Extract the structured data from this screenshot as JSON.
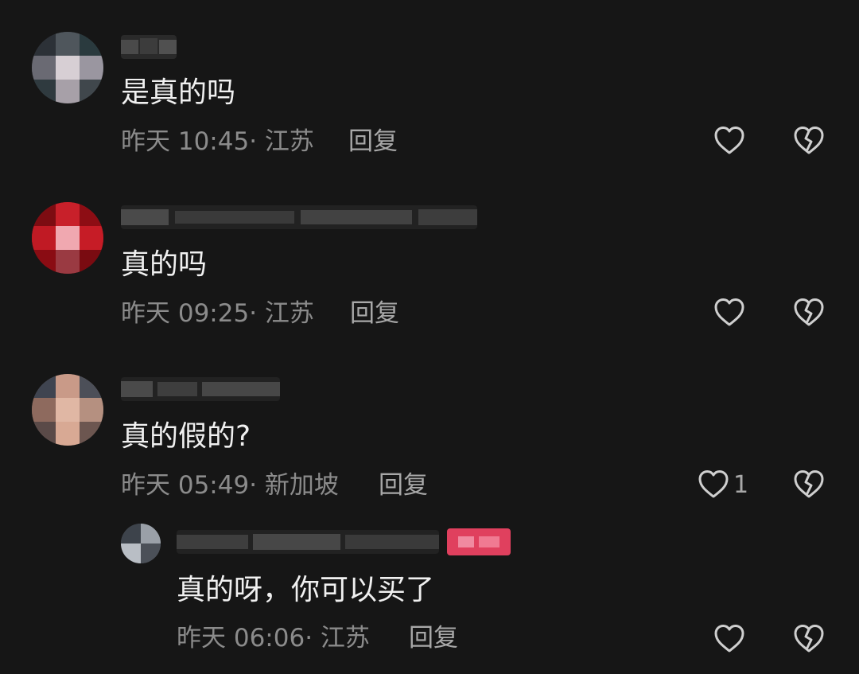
{
  "comments": [
    {
      "text": "是真的吗",
      "meta": "昨天 10:45· 江苏",
      "reply_label": "回复",
      "like_count": ""
    },
    {
      "text": "真的吗",
      "meta": "昨天 09:25· 江苏",
      "reply_label": "回复",
      "like_count": ""
    },
    {
      "text": "真的假的?",
      "meta": "昨天 05:49· 新加坡",
      "reply_label": "回复",
      "like_count": "1"
    }
  ],
  "reply": {
    "text": "真的呀，你可以买了",
    "meta": "昨天 06:06· 江苏",
    "reply_label": "回复",
    "like_count": ""
  },
  "icons": {
    "like": "heart-outline-icon",
    "dislike": "broken-heart-icon"
  },
  "colors": {
    "background": "#161616",
    "text": "#f0f0f0",
    "meta": "#8b8b8b",
    "icon": "#cfcfcf",
    "author_badge": "#e0405e"
  }
}
